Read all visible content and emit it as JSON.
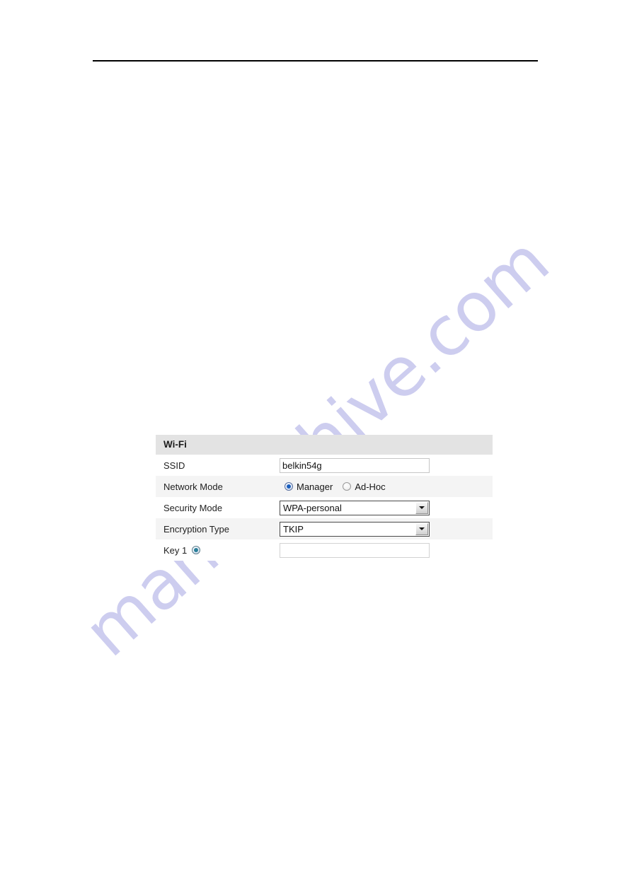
{
  "document": {
    "has_header_rule": true,
    "watermark_text": "manualshive.com",
    "watermark_color": "#cdcdef",
    "page_background": "#ffffff"
  },
  "panel": {
    "title": "Wi-Fi",
    "header_background": "#e3e3e3",
    "stripe_background": "#f4f4f4",
    "rows": [
      {
        "label": "SSID",
        "control": "text",
        "value": "belkin54g",
        "placeholder": ""
      },
      {
        "label": "Network Mode",
        "control": "radio-group",
        "options": [
          {
            "label": "Manager",
            "selected": true
          },
          {
            "label": "Ad-Hoc",
            "selected": false
          }
        ]
      },
      {
        "label": "Security Mode",
        "control": "select",
        "value": "WPA-personal"
      },
      {
        "label": "Encryption Type",
        "control": "select",
        "value": "TKIP"
      },
      {
        "label": "Key 1",
        "control": "text",
        "value": "",
        "placeholder": "",
        "has_radio": true,
        "radio_selected": true
      }
    ]
  },
  "icons": {
    "select_arrow": "chevron-down-icon"
  }
}
